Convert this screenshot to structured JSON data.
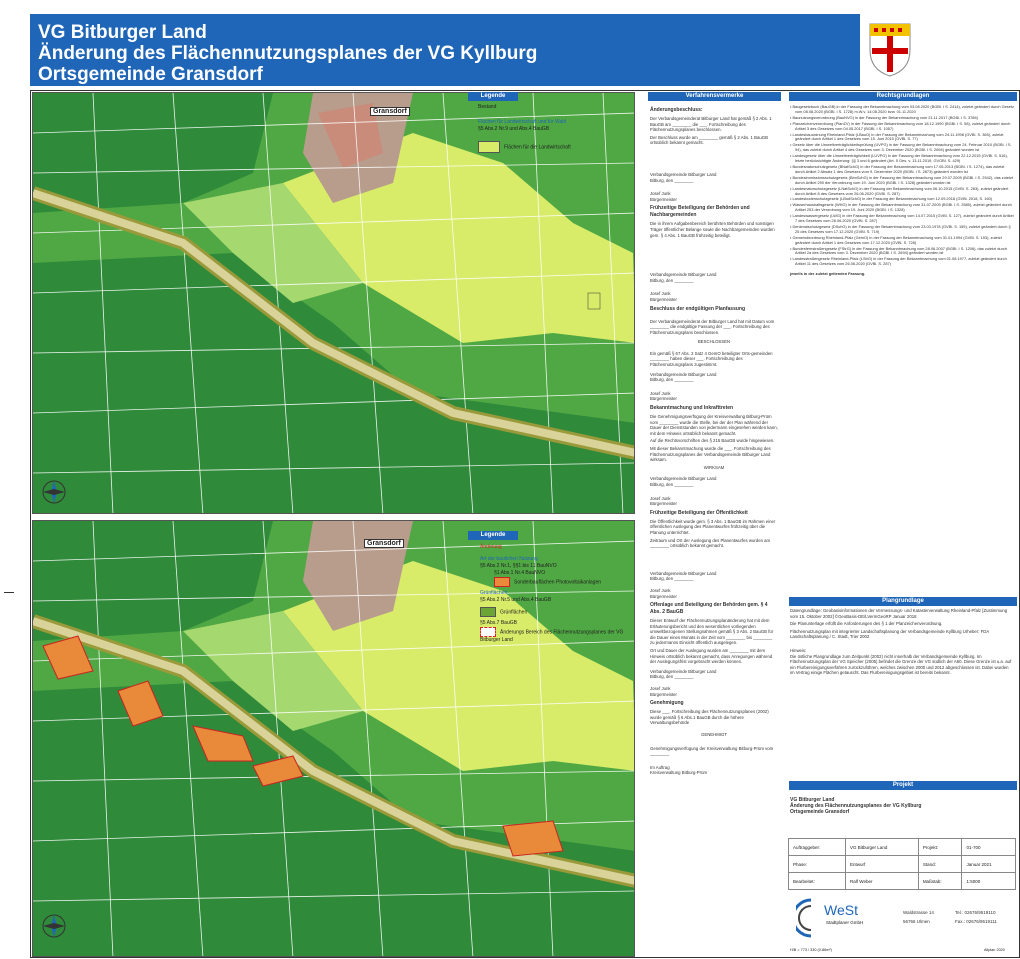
{
  "title": {
    "line1": "VG Bitburger Land",
    "line2": "Änderung des Flächennutzungsplanes der VG Kyllburg",
    "line3": "Ortsgemeinde Gransdorf"
  },
  "colors": {
    "brand": "#1f66b8",
    "forest": "#2f8a3a",
    "green_mid": "#4fa843",
    "green_light": "#a6d870",
    "agri_yellow": "#d8ec6a",
    "settlement": "#b89c8c",
    "orange": "#e88a3a",
    "road": "#9a9a3a"
  },
  "map_top": {
    "place_label": "Gransdorf",
    "legend_header": "Legende",
    "legend": {
      "bestand": "Bestand",
      "flaechen_landwirtschaft": "Flächen für Landwirtschaft und für Wald",
      "paragraph": "§5 Abs.2 Nr.9 und Abs.4 BauGB",
      "flaechen_fuer_landwirtschaft": "Flächen für die Landwirtschaft"
    }
  },
  "map_bottom": {
    "place_label": "Gransdorf",
    "legend_header": "Legende",
    "legend": {
      "aenderung": "Änderung",
      "art_baulichen": "Art der baulichen Nutzung",
      "para1": "§5 Abs.2 Nr.1, §§1 bis 11 BauNVO",
      "para1b": "§1 Abs.1 Nr.4 BauNVO",
      "sonderbau": "Sonderbauflächen Photovoltaikanlagen",
      "gruen": "Grünflächen",
      "para2": "§5 Abs.2 Nr.5 und Abs.4 BauGB",
      "gruenflaechen": "Grünflächen",
      "para3": "§5 Abs.7 BauGB",
      "aenderungsbereich": "Änderungs Bereich des Flächennutzungsplanes der VG Bitburger Land"
    }
  },
  "verfahren": {
    "header": "Verfahrensvermerke",
    "s1_title": "Änderungsbeschluss:",
    "s1_text": "Der Verbandsgemeinderat Bitburger Land hat gemäß § 2 Abs. 1 BauGB am ________ die ___. Fortschreibung des Flächennutzungsplanes beschlossen.",
    "s1_text2": "Der Beschluss wurde am ________ gemäß § 2 Abs. 1 BauGB ortsüblich bekannt gemacht.",
    "sig_place": "Verbandsgemeinde Bitburger Land",
    "sig_date": "Bitburg, den ________",
    "sig_name": "Josef Junk",
    "sig_role": "Bürgermeister",
    "s2_title": "Frühzeitige Beteiligung der Behörden und Nachbargemeinden",
    "s2_text": "Die in ihrem Aufgabenbereich berührten Behörden und sonstigen Träger öffentlicher Belange sowie die Nachbargemeinden wurden gem. § 4 Abs. 1 BauGB frühzeitig beteiligt.",
    "s3_title": "Beschluss der endgültigen Planfassung",
    "s3_text": "Der Verbandsgemeinderat der Bitburger Land hat mit Datum vom ________ die endgültige Fassung der ___. Fortschreibung des Flächennutzungsplans beschlossen.",
    "beglaubigt": "BESCHLOSSEN",
    "s3_text2": "Ein gemäß § 67 Abs. 2 Satz 4 GemO beteiligter Orts-gemeinden ________ haben dieser ___. Fortschreibung des Flächennutzungsplans zugestimmt.",
    "s4_title": "Bekanntmachung und Inkrafttreten",
    "s4_text": "Die Genehmigungsverfügung der Kreisverwaltung Bitburg-Prüm vom ________ wurde die Stelle, bei der der Plan während der Dauer der Dienststunden von jedermann eingesehen werden kann, mit dem Hinweis ortsüblich bekannt gemacht.",
    "s4_text2": "Auf die Rechtsvorschriften des § 215 BauGB wurde hingewiesen.",
    "s4_text3": "Mit dieser Bekanntmachung wurde die ___. Fortschreibung des Flächennutzungsplanes der Verbandsgemeinde Bitburger Land wirksam.",
    "wirksam": "WIRKSAM",
    "s5_title": "Frühzeitige Beteiligung der Öffentlichkeit",
    "s5_text": "Die Öffentlichkeit wurde gem. § 3 Abs. 1 BauGB im Rahmen einer öffentlichen Auslegung des Planentwurfes frühzeitig über die Planung unterrichtet.",
    "s5_text2": "Zeitraum und Ort der Auslegung des Planentwurfes wurden am ________ ortsüblich bekannt gemacht.",
    "s6_title": "Offenlage und Beteiligung der Behörden gem. § 4 Abs. 2 BauGB",
    "s6_text": "Dieser Entwurf der Flächennutzungsplanänderung hat mit dem Erläuterungsbericht und den wesentlichen vorliegenden umweltbezogenen Stellungnahmen gemäß § 3 Abs. 2 BauGB für die Dauer eines Monats in der Zeit vom ________ bis ________ zu jedermanns Einsicht öffentlich ausgelegen.",
    "s6_text2": "Ort und Dauer der Auslegung wurden am ________ mit dem Hinweis ortsüblich bekannt gemacht, dass Anregungen während der Auslegungsfrist vorgebracht werden können.",
    "s7_title": "Genehmigung",
    "s7_text": "Diese ___. Fortschreibung des Flächennutzungsplanes (2002) wurde gemäß § 6 Abs.1 BauGB durch die höhere Verwaltungsbehörde",
    "genehmigt": "GENEHMIGT",
    "s7_text2": "Genehmigungsverfügung der Kreisverwaltung Bitburg-Prüm vom ________",
    "im_auftrag": "Im Auftrag",
    "kv": "Kreisverwaltung Bitburg-Prüm"
  },
  "rechts": {
    "header": "Rechtsgrundlagen",
    "items": [
      "Baugesetzbuch (BauGB) in der Fassung der Bekanntmachung vom 03.08.2020 (BGBl. I S. 2414), zuletzt geändert durch Gesetz vom 08.08.2020 (BGBl. I S. 1728) m.W.v. 14.08.2020 bzw. 01.11.2020",
      "Baunutzungsverordnung (BauNVO) in der Fassung der Bekanntmachung vom 21.11.2017 (BGBl. I S. 3786)",
      "Planzeichenverordnung (PlanZV) in der Fassung der Bekanntmachung vom 18.12.1990 (BGBl. I S. 58), zuletzt geändert durch Artikel 3 des Gesetzes vom 04.05.2017 (BGBl. I S. 1057)",
      "Landesbauordnung Rheinland-Pfalz (LBauO) in der Fassung der Bekanntmachung vom 24.11.1998 (GVBl. S. 365), zuletzt geändert durch Artikel 1 des Gesetzes vom 15. Juni 2015 (GVBl. S. 77)",
      "Gesetz über die Umweltverträglichkeitsprüfung (UVPG) in der Fassung der Bekanntmachung vom 24. Februar 2010 (BGBl. I S. 94), das zuletzt durch Artikel 4 des Gesetzes vom 3. Dezember 2020 (BGBl. I S. 2694) geändert worden ist",
      "Landesgesetz über die Umweltverträglichkeit (LUVPG) in der Fassung der Bekanntmachung vom 22.12.2015 (GVBl. S. 516), letzte berücksichtigte Änderung: §§ 3 und 6 geändert (Art. 5 Ges. v. 13.11.2019, GVOBl. S. 429)",
      "Bundesnaturschutzgesetz (BNatSchG) in der Fassung der Bekanntmachung vom 17.05.2013 (BGBl. I S. 1274), das zuletzt durch Artikel 2 Absatz 1 des Gesetzes vom 9. Dezember 2020 (BGBl. I S. 2873) geändert worden ist",
      "Bundesimmissionsschutzgesetz (BImSchG) in der Fassung der Bekanntmachung vom 29.07.2009 (BGBl. I S. 2542), das zuletzt durch Artikel 290 der Verordnung vom 19. Juni 2020 (BGBl. I S. 1328) geändert worden ist",
      "Landesnaturschutzgesetz (LNatSchG) in der Fassung der Bekanntmachung vom 06.10.2015 (GVBl. S. 283), zuletzt geändert durch Artikel 8 des Gesetzes vom 26.06.2020 (GVBl. S. 287)",
      "Landesbodenschutzgesetz (LBodSchG) in der Fassung der Bekanntmachung vom 12.09.2018 (GVBl. 2018, S. 160)",
      "Wasserhaushaltsgesetz (WHG) in der Fassung der Bekanntmachung vom 31.07.2009 (BGBl. I S. 2585), zuletzt geändert durch Artikel 253 der Verordnung vom 19. Juni 2020 (BGBl. I S. 1328)",
      "Landeswassergesetz (LWG) in der Fassung der Bekanntmachung vom 14.07.2015 (GVBl. S. 127), zuletzt geändert durch Artikel 7 des Gesetzes vom 26.06.2020 (GVBl. S. 287)",
      "Denkmalschutzgesetz (DSchG) in der Fassung der Bekanntmachung vom 23.03.1978 (GVBl. S. 159), zuletzt geändert durch § 25 des Gesetzes vom 17.12.2020 (GVBl. S. 719)",
      "Gemeindeordnung Rheinland-Pfalz (GemO) in der Fassung der Bekanntmachung vom 31.01.1994 (GVBl. S. 153), zuletzt geändert durch Artikel 1 des Gesetzes vom 17.12.2020 (GVBl. S. 728)",
      "Bundesfernstraßengesetz (FStrG) in der Fassung der Bekanntmachung vom 28.06.2007 (BGBl. I S. 1206), das zuletzt durch Artikel 2a des Gesetzes vom 3. Dezember 2020 (BGBl. I S. 2694) geändert worden ist",
      "Landesstraßengesetz Rheinland-Pfalz (LStrG) in der Fassung der Bekanntmachung vom 01.08.1977, zuletzt geändert durch Artikel 11 des Gesetzes vom 26.06.2020 (GVBl. S. 287)"
    ],
    "footer": "jeweils in der zuletzt geltenden Fassung."
  },
  "plangrundlage": {
    "header": "Plangrundlage",
    "text1": "Datengrundlage: Geobasisinformationen der Vermessungs- und Katasterverwaltung Rheinland-Pfalz [Zustimmung vom 15. Oktober 2002] ©GeoBasis-DE/LVermGeoRP Januar 2018",
    "text2": "Die Planunterlage erfüllt die Anforderungen des § 1 der Planzeichenverordnung.",
    "text3": "Flächennutzungsplan mit integrierter Landschaftsplanung der Verbandsgemeinde Kyllburg Urheber: FDA Landschaftsplanung / C. Stadt, Trier 2002",
    "hinweis_title": "Hinweis:",
    "hinweis": "Die östliche Plangrundlage zum Zeitpunkt (2002) nicht innerhalb der Verbandsgemeinde Kyllburg. Im Flächennutzungsplan der VG Speicher (2005) befindet die Grenze der VG südlich der A60. Diese Grenze ist u.a. auf ein Flurbereinigungsverfahren zurückzuführen, welches zwischen 2000 und 2012 abgeschlossen ist. Dabei wurden im Vertrag einige Flächen getauscht. Das Flurbereinigungsgebiet ist bereits bekannt."
  },
  "projekt": {
    "header": "Projekt",
    "line1": "VG Bitburger Land",
    "line2": "Änderung des Flächennutzungsplanes der VG Kyllburg",
    "line3": "Ortsgemeinde Gransdorf",
    "auftraggeber_label": "Auftraggeber:",
    "auftraggeber": "VG Bitburger Land",
    "projekt_label": "Projekt:",
    "projekt_nr": "01-700",
    "phase_label": "Phase:",
    "phase": "Entwurf",
    "stand_label": "Stand:",
    "stand": "Januar 2021",
    "bearbeitet_label": "Bearbeitet:",
    "bearbeitet": "Ralf Weber",
    "massstab_label": "Maßstab:",
    "massstab": "1:5000",
    "company": "WeSt",
    "company_sub": "Stadtplaner GmbH",
    "street": "Waldstrasse 14",
    "city": "56766 Ulmen",
    "tel": "Tel.: 02676/9519110",
    "fax": "Fax.: 02676/9519111",
    "footer_left": "H/B = 773 / 330 (0.86m²)",
    "footer_right": "Allplan 2020"
  }
}
